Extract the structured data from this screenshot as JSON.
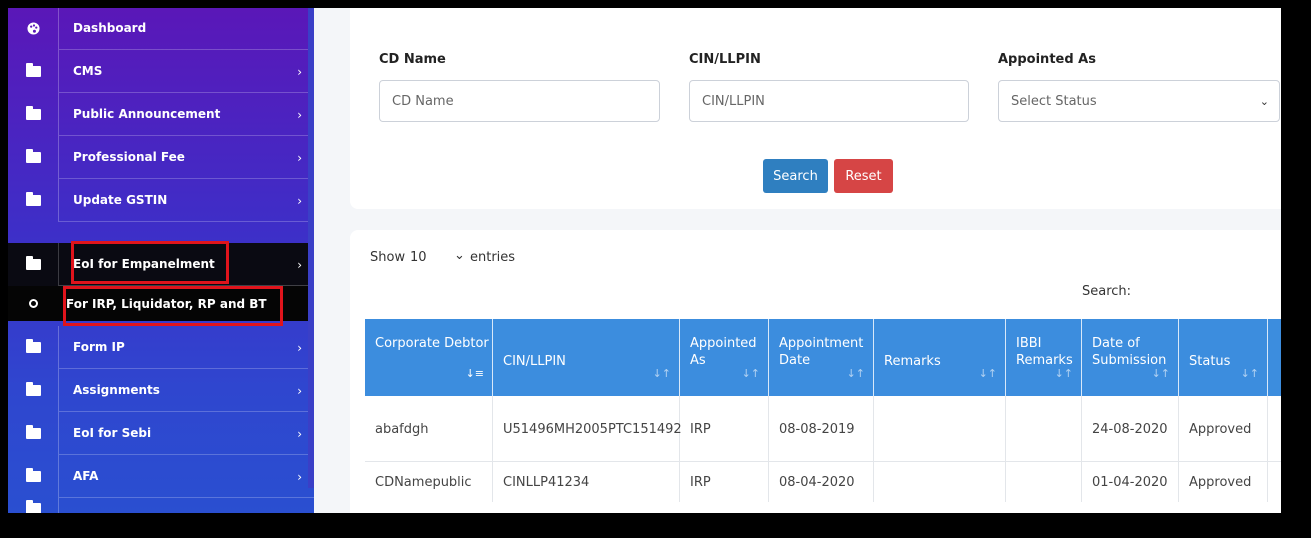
{
  "sidebar": {
    "items": [
      {
        "label": "Dashboard",
        "icon": "palette-icon",
        "has_chevron": false
      },
      {
        "label": "CMS",
        "icon": "folder-icon",
        "has_chevron": true
      },
      {
        "label": "Public Announcement",
        "icon": "folder-icon",
        "has_chevron": true
      },
      {
        "label": "Professional Fee",
        "icon": "folder-icon",
        "has_chevron": true
      },
      {
        "label": "Update GSTIN",
        "icon": "folder-icon",
        "has_chevron": true
      },
      {
        "label": "EoI for Empanelment",
        "icon": "folder-icon",
        "has_chevron": true,
        "active": true
      },
      {
        "label": "Form IP",
        "icon": "folder-icon",
        "has_chevron": true
      },
      {
        "label": "Assignments",
        "icon": "folder-icon",
        "has_chevron": true
      },
      {
        "label": "EoI for Sebi",
        "icon": "folder-icon",
        "has_chevron": true
      },
      {
        "label": "AFA",
        "icon": "folder-icon",
        "has_chevron": true
      }
    ],
    "sub_item": {
      "label": "For IRP, Liquidator, RP and BT"
    },
    "chevron": "›"
  },
  "filters": {
    "cd_name": {
      "label": "CD Name",
      "placeholder": "CD Name"
    },
    "cin": {
      "label": "CIN/LLPIN",
      "placeholder": "CIN/LLPIN"
    },
    "appointed_as": {
      "label": "Appointed As",
      "selected": "Select Status",
      "caret": "⌄"
    },
    "search_label": "Search",
    "reset_label": "Reset"
  },
  "table_controls": {
    "show_label": "Show",
    "page_size": "10",
    "entries_label": "entries",
    "search_label": "Search:",
    "caret": "⌄"
  },
  "table": {
    "columns": [
      {
        "label": "Corporate Debtor",
        "sort": "↓≡"
      },
      {
        "label": "CIN/LLPIN",
        "sort": "↓↑"
      },
      {
        "label": "Appointed As",
        "sort": "↓↑"
      },
      {
        "label": "Appointment Date",
        "sort": "↓↑"
      },
      {
        "label": "Remarks",
        "sort": "↓↑"
      },
      {
        "label": "IBBI Remarks",
        "sort": "↓↑"
      },
      {
        "label": "Date of Submission",
        "sort": "↓↑"
      },
      {
        "label": "Status",
        "sort": "↓↑"
      }
    ],
    "rows": [
      [
        "abafdgh",
        "U51496MH2005PTC151492",
        "IRP",
        "08-08-2019",
        "",
        "",
        "24-08-2020",
        "Approved"
      ],
      [
        "CDNamepublic",
        "CINLLP41234",
        "IRP",
        "08-04-2020",
        "",
        "",
        "01-04-2020",
        "Approved"
      ]
    ]
  },
  "colors": {
    "sidebar_top": "#5a17b8",
    "sidebar_bottom": "#2a4fd0",
    "table_header": "#3c8dde",
    "search_button": "#2f7fc0",
    "reset_button": "#d64545",
    "highlight_box": "#e0141c"
  }
}
